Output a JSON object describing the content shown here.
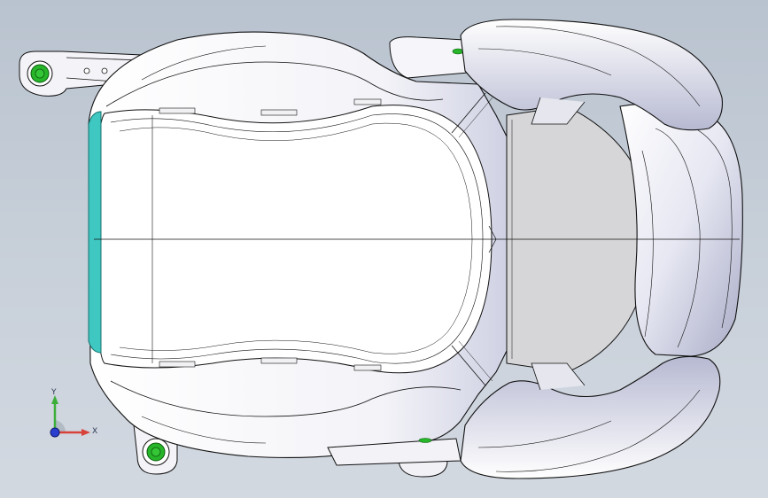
{
  "window": {
    "viewport_background_top": "#b9c3cf",
    "viewport_background_bottom": "#d3d9e1"
  },
  "model": {
    "view": "top",
    "part_colors": {
      "seat_shell": "#ffffff",
      "shell_shading": "#cdd0e2",
      "back_panel": "#d6d6d8",
      "edge_lines": "#111111",
      "hinge_knob": "#27b52a",
      "trim_strip": "#3fc7c1"
    }
  },
  "triad": {
    "x_label": "X",
    "y_label": "Y",
    "x_color": "#d7423a",
    "y_color": "#3dae3a",
    "z_color": "#2a3fd0"
  }
}
